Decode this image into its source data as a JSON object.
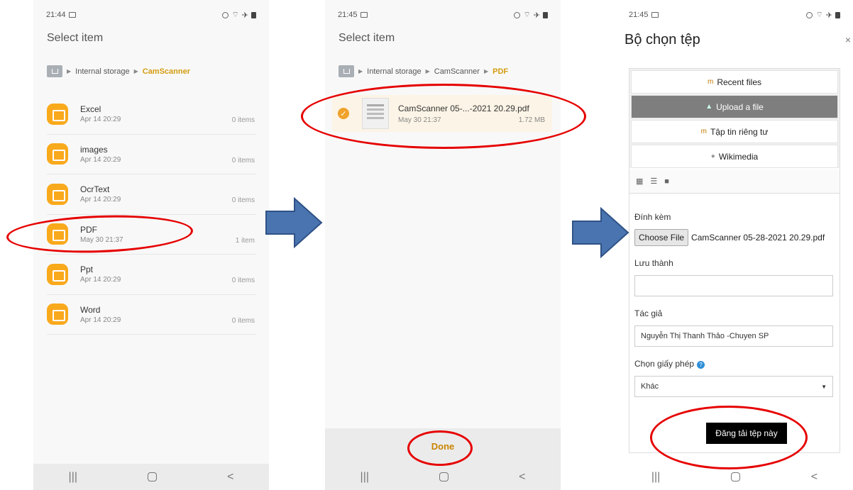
{
  "screen1": {
    "time": "21:44",
    "title": "Select item",
    "breadcrumb": [
      "Internal storage",
      "CamScanner"
    ],
    "folders": [
      {
        "name": "Excel",
        "date": "Apr 14 20:29",
        "count": "0 items"
      },
      {
        "name": "images",
        "date": "Apr 14 20:29",
        "count": "0 items"
      },
      {
        "name": "OcrText",
        "date": "Apr 14 20:29",
        "count": "0 items"
      },
      {
        "name": "PDF",
        "date": "May 30 21:37",
        "count": "1 item"
      },
      {
        "name": "Ppt",
        "date": "Apr 14 20:29",
        "count": "0 items"
      },
      {
        "name": "Word",
        "date": "Apr 14 20:29",
        "count": "0 items"
      }
    ]
  },
  "screen2": {
    "time": "21:45",
    "title": "Select item",
    "breadcrumb": [
      "Internal storage",
      "CamScanner",
      "PDF"
    ],
    "file": {
      "name": "CamScanner 05-...-2021 20.29.pdf",
      "date": "May 30 21:37",
      "size": "1.72 MB"
    },
    "done_label": "Done"
  },
  "screen3": {
    "time": "21:45",
    "title": "Bộ chọn tệp",
    "close": "×",
    "repositories": [
      "Recent files",
      "Upload a file",
      "Tập tin riêng tư",
      "Wikimedia"
    ],
    "attach_label": "Đính kèm",
    "choose_file_label": "Choose File",
    "chosen_file": "CamScanner 05-28-2021 20.29.pdf",
    "save_as_label": "Lưu thành",
    "save_as_value": "",
    "author_label": "Tác giả",
    "author_value": "Nguyễn Thị Thanh Thảo -Chuyen SP",
    "license_label": "Chọn giấy phép",
    "license_value": "Khác",
    "upload_label": "Đăng tải tệp này"
  },
  "nav": {
    "recents": "|||",
    "back": "<"
  },
  "colors": {
    "accent": "#d49c10",
    "folder": "#f9a91c",
    "annotation": "#e60000",
    "arrow": "#4a74b0"
  }
}
